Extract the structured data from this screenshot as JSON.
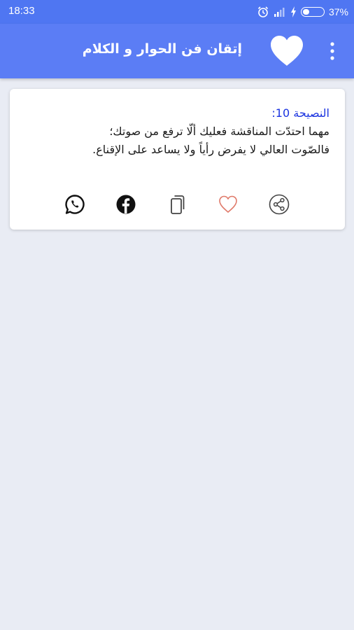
{
  "status": {
    "time": "18:33",
    "battery": "37%",
    "battery_level": 0.37
  },
  "app_bar": {
    "title": "إتقان فن الحوار و الكلام"
  },
  "card": {
    "heading": "النصيحة 10:",
    "line1": "مهما احتدّت المناقشة فعليك ألّا ترفع من صوتك؛",
    "line2": "فالصّوت العالي لا يفرض رأياً ولا يساعد على الإقناع."
  },
  "actions": [
    {
      "icon": "share-icon"
    },
    {
      "icon": "favorite-outline-icon",
      "color": "#e07a6a"
    },
    {
      "icon": "copy-icon"
    },
    {
      "icon": "facebook-icon"
    },
    {
      "icon": "whatsapp-icon"
    }
  ],
  "colors": {
    "status_bar": "#4f76f2",
    "app_bar": "#5b7df5",
    "background": "#e9ecf4",
    "heading": "#1a33e0"
  }
}
